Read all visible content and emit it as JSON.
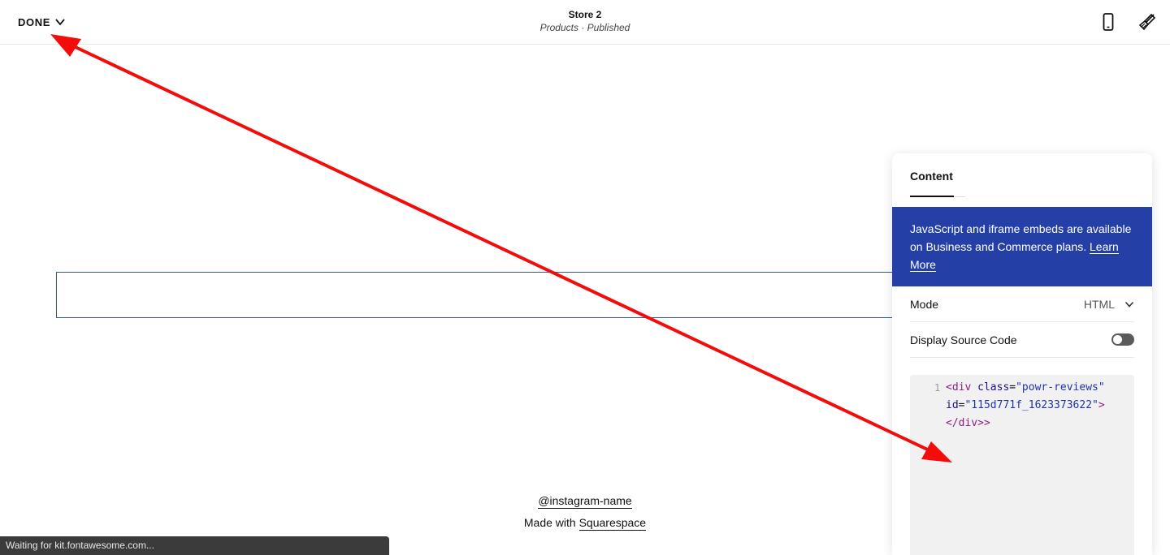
{
  "topbar": {
    "done_label": "DONE",
    "title": "Store 2",
    "subtitle": "Products · Published",
    "icons": [
      "chevron-down-icon",
      "mobile-phone-icon",
      "paintbrush-icon"
    ]
  },
  "footer": {
    "instagram": "@instagram-name",
    "made_with": "Made with ",
    "made_with_link": "Squarespace"
  },
  "status_bar": {
    "text": "Waiting for kit.fontawesome.com..."
  },
  "panel": {
    "tab_label": "Content",
    "notice_text": "JavaScript and iframe embeds are available on Business and Commerce plans. ",
    "notice_link": "Learn More",
    "mode_label": "Mode",
    "mode_value": "HTML",
    "source_label": "Display Source Code",
    "source_enabled": false,
    "code": {
      "line_number": "1",
      "open_tag": "<div",
      "class_attr": "class",
      "class_value": "\"powr-reviews\"",
      "id_attr": "id",
      "id_value": "\"115d771f_1623373622\"",
      "close_tag": "</div>"
    }
  },
  "colors": {
    "accent_blue": "#2440a7",
    "annotation_red": "#f20c0c",
    "block_outline": "#3550b5"
  }
}
